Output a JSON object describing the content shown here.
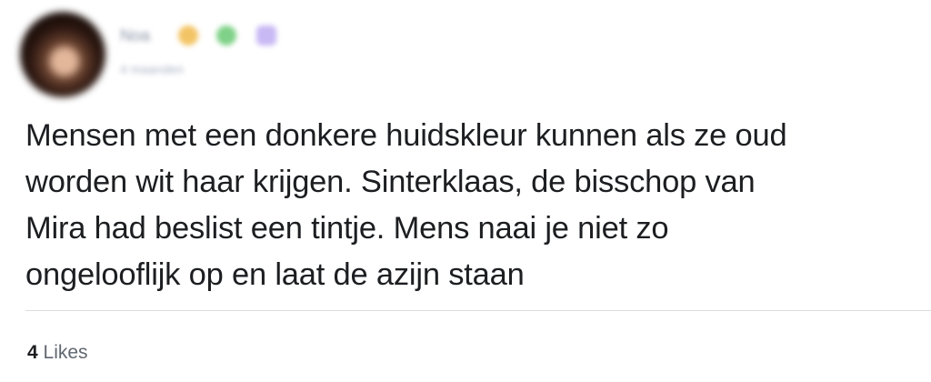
{
  "author": {
    "name": "Noa",
    "meta": "4 maanden",
    "badges": [
      {
        "icon": "star-badge-icon",
        "color": "#f3c465"
      },
      {
        "icon": "plus-badge-icon",
        "color": "#7fd187"
      },
      {
        "icon": "square-badge-icon",
        "color": "#c8b8f4"
      }
    ]
  },
  "post": {
    "lines": [
      "Mensen met een donkere huidskleur kunnen als ze oud",
      "worden wit haar krijgen. Sinterklaas, de bisschop van",
      "Mira had beslist een tintje. Mens naai je niet zo",
      "ongelooflijk op en laat de azijn staan"
    ]
  },
  "footer": {
    "likes_count": "4",
    "likes_label": "Likes"
  }
}
